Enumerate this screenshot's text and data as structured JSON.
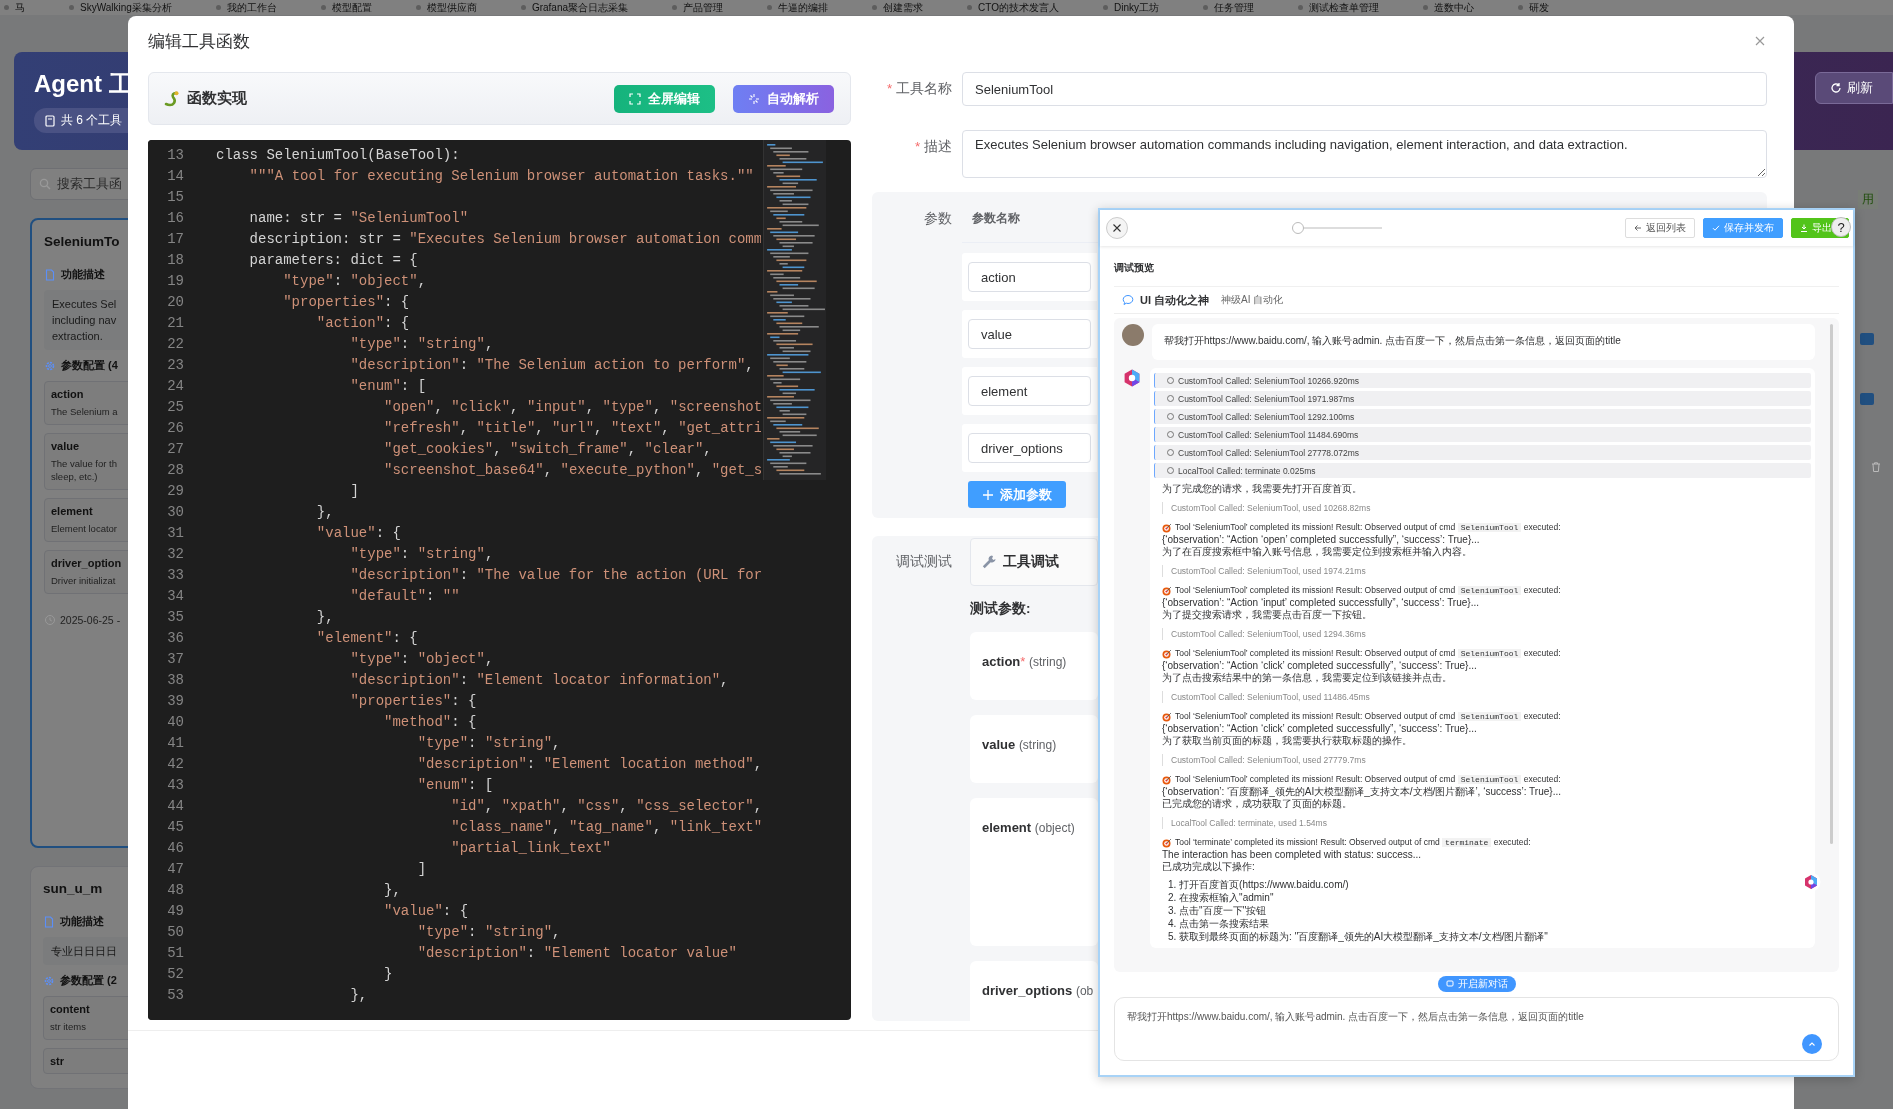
{
  "top_nav": {
    "items": [
      "马",
      "SkyWalking采集分析",
      "我的工作台",
      "模型配置",
      "模型供应商",
      "Grafana聚合日志采集",
      "产品管理",
      "牛逼的编排",
      "创建需求",
      "CTO的技术发言人",
      "Dinky工坊",
      "任务管理",
      "测试检查单管理",
      "造数中心",
      "研发"
    ]
  },
  "background": {
    "header_title": "Agent 工",
    "tool_count": "共 6 个工具",
    "refresh_button": "刷新",
    "search_placeholder": "搜索工具函",
    "status_text": "用",
    "cards": [
      {
        "title": "SeleniumTo",
        "selected": true,
        "desc_label": "功能描述",
        "description": "Executes Sel\nincluding nav\nextraction.",
        "params_label": "参数配置 (4",
        "params": [
          {
            "name": "action",
            "description": "The Selenium a"
          },
          {
            "name": "value",
            "description": "The value for th\nsleep, etc.)"
          },
          {
            "name": "element",
            "description": "Element locator"
          },
          {
            "name": "driver_option",
            "description": "Driver initializat"
          }
        ],
        "date": "2025-06-25 -"
      },
      {
        "title": "sun_u_m",
        "selected": false,
        "desc_label": "功能描述",
        "description": "专业日日日日",
        "params_label": "参数配置 (2",
        "params": [
          {
            "name": "content",
            "description": "str items"
          },
          {
            "name": "str"
          }
        ]
      }
    ]
  },
  "modal": {
    "title": "编辑工具函数",
    "code_panel": {
      "title": "函数实现",
      "buttons": [
        {
          "label": "全屏编辑",
          "kind": "fullscreen"
        },
        {
          "label": "自动解析",
          "kind": "parse"
        }
      ],
      "lines": [
        {
          "number": "13",
          "code": "class SeleniumTool(BaseTool):"
        },
        {
          "number": "14",
          "code": "    \"\"\"A tool for executing Selenium browser automation tasks.\"\""
        },
        {
          "number": "15"
        },
        {
          "number": "16",
          "code": "    name: str = \"SeleniumTool\""
        },
        {
          "number": "17",
          "code": "    description: str = \"Executes Selenium browser automation comm"
        },
        {
          "number": "18",
          "code": "    parameters: dict = {"
        },
        {
          "number": "19",
          "code": "        \"type\": \"object\","
        },
        {
          "number": "20",
          "code": "        \"properties\": {"
        },
        {
          "number": "21",
          "code": "            \"action\": {"
        },
        {
          "number": "22",
          "code": "                \"type\": \"string\","
        },
        {
          "number": "23",
          "code": "                \"description\": \"The Selenium action to perform\","
        },
        {
          "number": "24",
          "code": "                \"enum\": ["
        },
        {
          "number": "25",
          "code": "                    \"open\", \"click\", \"input\", \"type\", \"screenshot"
        },
        {
          "number": "26",
          "code": "                    \"refresh\", \"title\", \"url\", \"text\", \"get_attri"
        },
        {
          "number": "27",
          "code": "                    \"get_cookies\", \"switch_frame\", \"clear\","
        },
        {
          "number": "28",
          "code": "                    \"screenshot_base64\", \"execute_python\", \"get_s"
        },
        {
          "number": "29",
          "code": "                ]"
        },
        {
          "number": "30",
          "code": "            },"
        },
        {
          "number": "31",
          "code": "            \"value\": {"
        },
        {
          "number": "32",
          "code": "                \"type\": \"string\","
        },
        {
          "number": "33",
          "code": "                \"description\": \"The value for the action (URL for"
        },
        {
          "number": "34",
          "code": "                \"default\": \"\""
        },
        {
          "number": "35",
          "code": "            },"
        },
        {
          "number": "36",
          "code": "            \"element\": {"
        },
        {
          "number": "37",
          "code": "                \"type\": \"object\","
        },
        {
          "number": "38",
          "code": "                \"description\": \"Element locator information\","
        },
        {
          "number": "39",
          "code": "                \"properties\": {"
        },
        {
          "number": "40",
          "code": "                    \"method\": {"
        },
        {
          "number": "41",
          "code": "                        \"type\": \"string\","
        },
        {
          "number": "42",
          "code": "                        \"description\": \"Element location method\","
        },
        {
          "number": "43",
          "code": "                        \"enum\": ["
        },
        {
          "number": "44",
          "code": "                            \"id\", \"xpath\", \"css\", \"css_selector\","
        },
        {
          "number": "45",
          "code": "                            \"class_name\", \"tag_name\", \"link_text\""
        },
        {
          "number": "46",
          "code": "                            \"partial_link_text\""
        },
        {
          "number": "47",
          "code": "                        ]"
        },
        {
          "number": "48",
          "code": "                    },"
        },
        {
          "number": "49",
          "code": "                    \"value\": {"
        },
        {
          "number": "50",
          "code": "                        \"type\": \"string\","
        },
        {
          "number": "51",
          "code": "                        \"description\": \"Element locator value\""
        },
        {
          "number": "52",
          "code": "                    }"
        },
        {
          "number": "53",
          "code": "                },"
        }
      ]
    },
    "form": {
      "name_label": "工具名称",
      "name_required_mark": "*",
      "name_value": "SeleniumTool",
      "description_label": "描述",
      "description_required_mark": "*",
      "description_value": "Executes Selenium browser automation commands including navigation, element interaction, and data extraction.",
      "params_label": "参数",
      "params_header": "参数名称",
      "params": [
        "action",
        "value",
        "element",
        "driver_options"
      ],
      "add_param_button": "添加参数",
      "debug_label": "调试测试",
      "debug_card_title": "工具调试",
      "test_params_label": "测试参数:",
      "test_params": [
        {
          "name": "action",
          "required_mark": "*",
          "type": "(string)",
          "kind": "text"
        },
        {
          "name": "value",
          "type": "(string)",
          "kind": "text"
        },
        {
          "name": "element",
          "type": "(object)",
          "kind": "object"
        },
        {
          "name": "driver_options",
          "type": "(ob",
          "kind": "text"
        }
      ]
    }
  },
  "popup": {
    "slider": {
      "level": 0
    },
    "buttons": [
      {
        "label": "返回列表",
        "kind": "back"
      },
      {
        "label": "保存并发布",
        "kind": "publish"
      },
      {
        "label": "导出",
        "kind": "export"
      }
    ],
    "help_label": "?",
    "title": "调试预览",
    "chat_name": "UI 自动化之神",
    "chat_subtitle": "神级AI 自动化",
    "user_message": "帮我打开https://www.baidu.com/, 输入账号admin. 点击百度一下，然后点击第一条信息，返回页面的title",
    "tool_calls": [
      "CustomTool Called: SeleniumTool 10266.920ms",
      "CustomTool Called: SeleniumTool 1971.987ms",
      "CustomTool Called: SeleniumTool 1292.100ms",
      "CustomTool Called: SeleniumTool 11484.690ms",
      "CustomTool Called: SeleniumTool 27778.072ms",
      "LocalTool Called: terminate 0.025ms"
    ],
    "steps": [
      {
        "kind": "text",
        "text": "为了完成您的请求，我需要先打开百度首页。"
      },
      {
        "kind": "quote",
        "text": "CustomTool Called: SeleniumTool, used 10268.82ms"
      },
      {
        "kind": "result",
        "before": "Tool ‘SeleniumTool’ completed its mission! Result: Observed output of cmd",
        "code": "SeleniumTool",
        "after": "executed:",
        "lines": [
          "{‘observation’: “Action ‘open’ completed successfully”, ‘success’: True}...",
          "为了在百度搜索框中输入账号信息，我需要定位到搜索框并输入内容。"
        ]
      },
      {
        "kind": "quote",
        "text": "CustomTool Called: SeleniumTool, used 1974.21ms"
      },
      {
        "kind": "result",
        "before": "Tool ‘SeleniumTool’ completed its mission! Result: Observed output of cmd",
        "code": "SeleniumTool",
        "after": "executed:",
        "lines": [
          "{‘observation’: “Action ‘input’ completed successfully”, ‘success’: True}...",
          "为了提交搜索请求，我需要点击百度一下按钮。"
        ]
      },
      {
        "kind": "quote",
        "text": "CustomTool Called: SeleniumTool, used 1294.36ms"
      },
      {
        "kind": "result",
        "before": "Tool ‘SeleniumTool’ completed its mission! Result: Observed output of cmd",
        "code": "SeleniumTool",
        "after": "executed:",
        "lines": [
          "{‘observation’: “Action ‘click’ completed successfully”, ‘success’: True}...",
          "为了点击搜索结果中的第一条信息，我需要定位到该链接并点击。"
        ]
      },
      {
        "kind": "quote",
        "text": "CustomTool Called: SeleniumTool, used 11486.45ms"
      },
      {
        "kind": "result",
        "before": "Tool ‘SeleniumTool’ completed its mission! Result: Observed output of cmd",
        "code": "SeleniumTool",
        "after": "executed:",
        "lines": [
          "{‘observation’: “Action ‘click’ completed successfully”, ‘success’: True}...",
          "为了获取当前页面的标题，我需要执行获取标题的操作。"
        ]
      },
      {
        "kind": "quote",
        "text": "CustomTool Called: SeleniumTool, used 27779.7ms"
      },
      {
        "kind": "result",
        "before": "Tool ‘SeleniumTool’ completed its mission! Result: Observed output of cmd",
        "code": "SeleniumTool",
        "after": "executed:",
        "lines": [
          "{‘observation’: ‘百度翻译_领先的AI大模型翻译_支持文本/文档/图片翻译’, ‘success’: True}...",
          "已完成您的请求，成功获取了页面的标题。"
        ]
      },
      {
        "kind": "quote",
        "text": "LocalTool Called: terminate, used 1.54ms"
      },
      {
        "kind": "result",
        "before": "Tool ‘terminate’ completed its mission! Result: Observed output of cmd",
        "code": "terminate",
        "after": "executed:",
        "lines": [
          "The interaction has been completed with status: success...",
          "已成功完成以下操作:"
        ]
      },
      {
        "kind": "list",
        "items": [
          "1. 打开百度首页(https://www.baidu.com/)",
          "2. 在搜索框输入\"admin\"",
          "3. 点击\"百度一下\"按钮",
          "4. 点击第一条搜索结果",
          "5. 获取到最终页面的标题为: \"百度翻译_领先的AI大模型翻译_支持文本/文档/图片翻译\""
        ]
      }
    ],
    "new_chat_button": "开启新对话",
    "input_value": "帮我打开https://www.baidu.com/, 输入账号admin. 点击百度一下，然后点击第一条信息，返回页面的title"
  }
}
